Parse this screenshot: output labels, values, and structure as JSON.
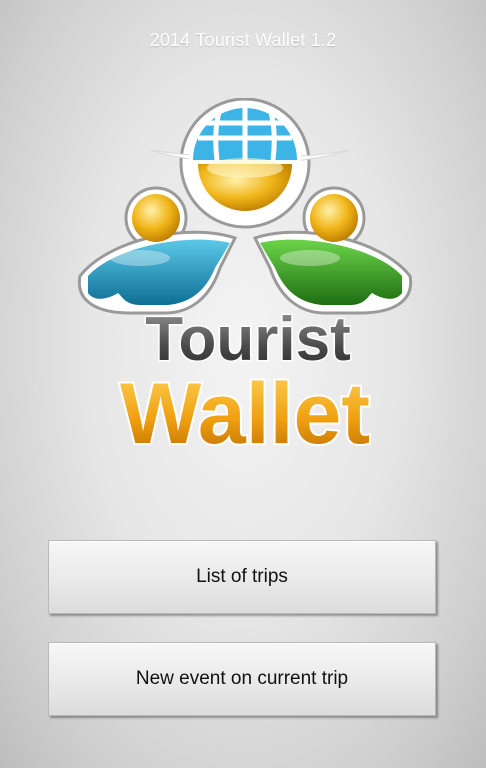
{
  "app": {
    "title": "2014 Tourist Wallet 1.2"
  },
  "logo": {
    "word1": "Tourist",
    "word2": "Wallet",
    "colors": {
      "globe_blue": "#3cb4e6",
      "head_gold": "#f0b418",
      "person_left_teal": "#1a8fb4",
      "person_right_green": "#2e8f1f",
      "word1_gray": "#555555",
      "word2_orange": "#e08a0a"
    }
  },
  "menu": {
    "list_trips_label": "List of trips",
    "new_event_label": "New event on current trip"
  }
}
